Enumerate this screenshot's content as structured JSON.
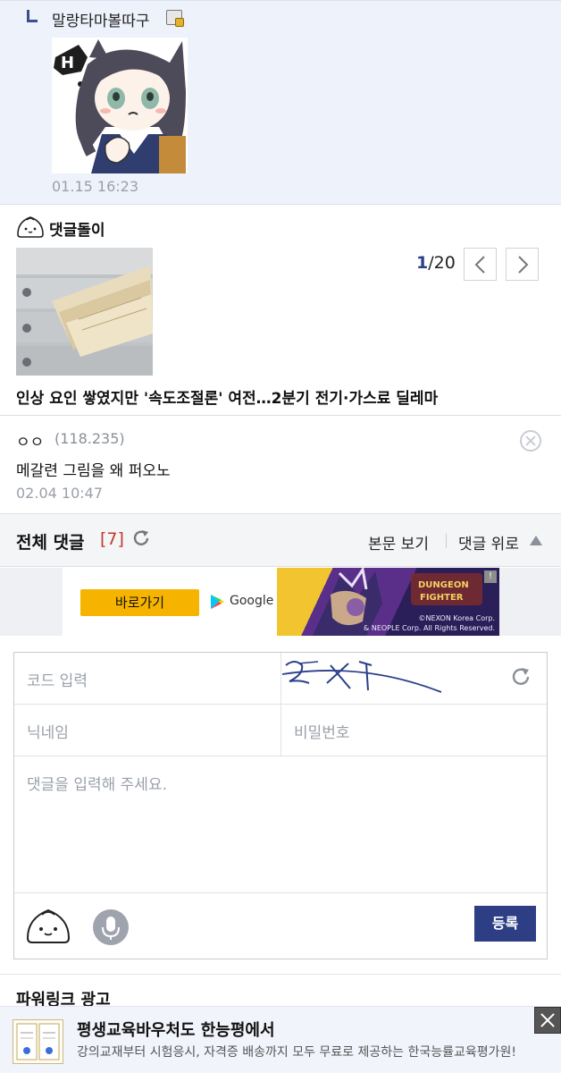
{
  "reply": {
    "nickname": "말랑타마볼따구",
    "time": "01.15 16:23"
  },
  "dori": {
    "title": "댓글돌이",
    "page_current": "1",
    "page_total": "/20",
    "news_title": "인상 요인 쌓였지만 '속도조절론' 여전…2분기 전기·가스료 딜레마"
  },
  "comment": {
    "nickname": "ㅇㅇ",
    "ip": "(118.235)",
    "text": "메갈련 그림을 왜 퍼오노",
    "time": "02.04 10:47"
  },
  "comments_bar": {
    "title": "전체 댓글",
    "count": "[7]",
    "view_post": "본문 보기",
    "to_top": "댓글 위로"
  },
  "ad_banner": {
    "go_label": "바로가기",
    "store_label": "Google Play",
    "copyright_1": "©NEXON Korea Corp.",
    "copyright_2": "& NEOPLE Corp. All Rights Reserved.",
    "info_icon": "!"
  },
  "form": {
    "code_placeholder": "코드 입력",
    "nickname_placeholder": "닉네임",
    "password_placeholder": "비밀번호",
    "text_placeholder": "댓글을 입력해 주세요.",
    "submit_label": "등록"
  },
  "powerlink": {
    "title": "파워링크 광고",
    "ad_title": "평생교육바우처도 한능평에서",
    "ad_desc": "강의교재부터 시험응시, 자격증 배송까지 모두 무료로 제공하는 한국능률교육평가원!"
  },
  "colors": {
    "accent": "#2d3e85",
    "count_red": "#c0392b",
    "ad_yellow": "#f6b400",
    "reply_bg": "#eef2fb"
  }
}
